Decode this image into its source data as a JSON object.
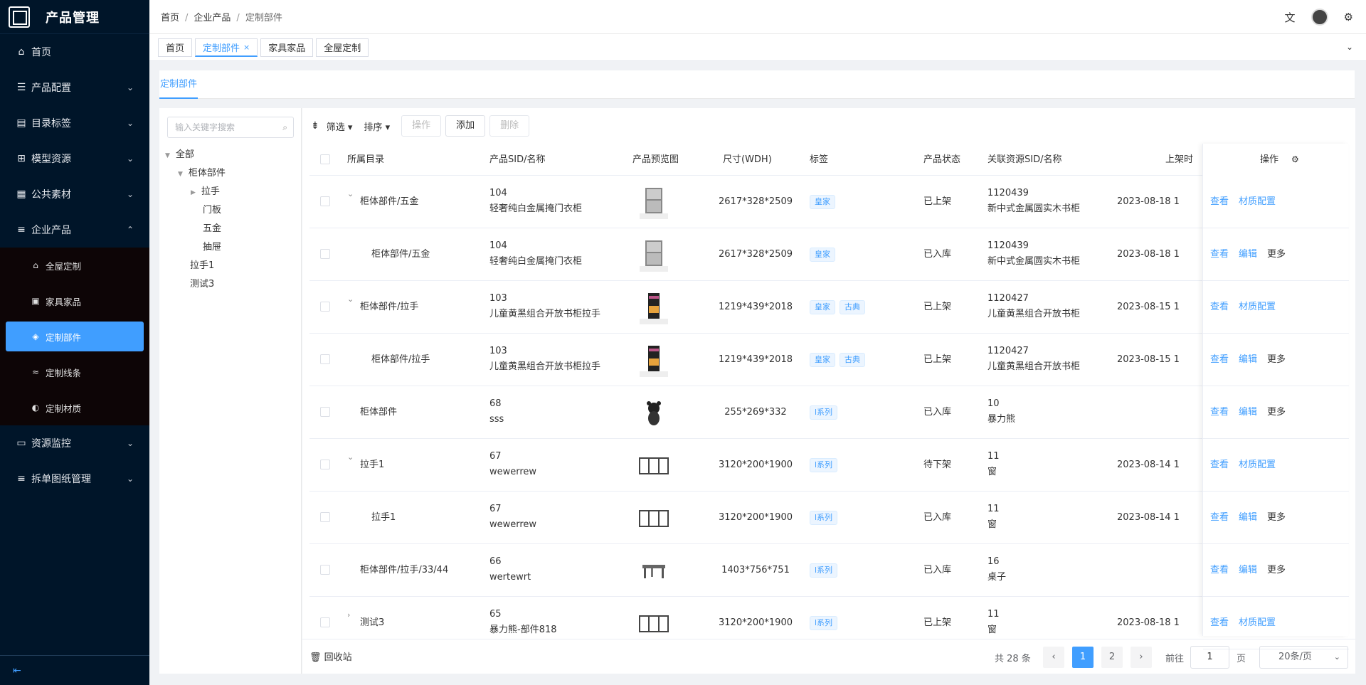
{
  "app": {
    "title": "产品管理"
  },
  "sidebar": {
    "items": [
      {
        "label": "首页",
        "icon": "home-icon"
      },
      {
        "label": "产品配置",
        "icon": "list-icon"
      },
      {
        "label": "目录标签",
        "icon": "document-icon"
      },
      {
        "label": "模型资源",
        "icon": "grid-icon"
      },
      {
        "label": "公共素材",
        "icon": "table-icon"
      },
      {
        "label": "企业产品",
        "icon": "database-icon"
      }
    ],
    "subitems": [
      {
        "label": "全屋定制",
        "icon": "house-icon"
      },
      {
        "label": "家具家品",
        "icon": "cabinet-icon"
      },
      {
        "label": "定制部件",
        "icon": "layers-icon"
      },
      {
        "label": "定制线条",
        "icon": "lines-icon"
      },
      {
        "label": "定制材质",
        "icon": "palette-icon"
      }
    ],
    "items_after": [
      {
        "label": "资源监控",
        "icon": "monitor-icon"
      },
      {
        "label": "拆单图纸管理",
        "icon": "database-icon"
      }
    ]
  },
  "breadcrumb": [
    "首页",
    "企业产品",
    "定制部件"
  ],
  "tags": [
    "首页",
    "定制部件",
    "家具家品",
    "全屋定制"
  ],
  "inner_tab": "定制部件",
  "tree": {
    "search_placeholder": "输入关键字搜索",
    "nodes": [
      "全部",
      "柜体部件",
      "拉手",
      "门板",
      "五金",
      "抽屉",
      "拉手1",
      "测试3"
    ]
  },
  "toolbar": {
    "filter": "筛选",
    "sort": "排序",
    "operate": "操作",
    "add": "添加",
    "delete": "删除"
  },
  "table": {
    "headers": {
      "catalog": "所属目录",
      "sid": "产品SID/名称",
      "preview": "产品预览图",
      "size": "尺寸(WDH)",
      "tags": "标签",
      "status": "产品状态",
      "resource": "关联资源SID/名称",
      "listed": "上架时",
      "actions": "操作"
    },
    "rows": [
      {
        "catalog": "柜体部件/五金",
        "sid": "104",
        "name": "轻奢纯白金属掩门衣柜",
        "size": "2617*328*2509",
        "tags": [
          "皇家"
        ],
        "status": "已上架",
        "rsid": "1120439",
        "rname": "新中式金属圆实木书柜",
        "date": "2023-08-18 1",
        "actions": [
          "查看",
          "材质配置"
        ]
      },
      {
        "catalog": "柜体部件/五金",
        "sid": "104",
        "name": "轻奢纯白金属掩门衣柜",
        "size": "2617*328*2509",
        "tags": [
          "皇家"
        ],
        "status": "已入库",
        "rsid": "1120439",
        "rname": "新中式金属圆实木书柜",
        "date": "2023-08-18 1",
        "actions": [
          "查看",
          "编辑",
          "更多"
        ]
      },
      {
        "catalog": "柜体部件/拉手",
        "sid": "103",
        "name": "儿童黄黑组合开放书柜拉手",
        "size": "1219*439*2018",
        "tags": [
          "皇家",
          "古典"
        ],
        "status": "已上架",
        "rsid": "1120427",
        "rname": "儿童黄黑组合开放书柜",
        "date": "2023-08-15 1",
        "actions": [
          "查看",
          "材质配置"
        ]
      },
      {
        "catalog": "柜体部件/拉手",
        "sid": "103",
        "name": "儿童黄黑组合开放书柜拉手",
        "size": "1219*439*2018",
        "tags": [
          "皇家",
          "古典"
        ],
        "status": "已上架",
        "rsid": "1120427",
        "rname": "儿童黄黑组合开放书柜",
        "date": "2023-08-15 1",
        "actions": [
          "查看",
          "编辑",
          "更多"
        ]
      },
      {
        "catalog": "柜体部件",
        "sid": "68",
        "name": "sss",
        "size": "255*269*332",
        "tags": [
          "l系列"
        ],
        "status": "已入库",
        "rsid": "10",
        "rname": "暴力熊",
        "date": "",
        "actions": [
          "查看",
          "编辑",
          "更多"
        ]
      },
      {
        "catalog": "拉手1",
        "sid": "67",
        "name": "wewerrew",
        "size": "3120*200*1900",
        "tags": [
          "l系列"
        ],
        "status": "待下架",
        "rsid": "11",
        "rname": "窗",
        "date": "2023-08-14 1",
        "actions": [
          "查看",
          "材质配置"
        ]
      },
      {
        "catalog": "拉手1",
        "sid": "67",
        "name": "wewerrew",
        "size": "3120*200*1900",
        "tags": [
          "l系列"
        ],
        "status": "已入库",
        "rsid": "11",
        "rname": "窗",
        "date": "2023-08-14 1",
        "actions": [
          "查看",
          "编辑",
          "更多"
        ]
      },
      {
        "catalog": "柜体部件/拉手/33/44",
        "sid": "66",
        "name": "wertewrt",
        "size": "1403*756*751",
        "tags": [
          "l系列"
        ],
        "status": "已入库",
        "rsid": "16",
        "rname": "桌子",
        "date": "",
        "actions": [
          "查看",
          "编辑",
          "更多"
        ]
      },
      {
        "catalog": "测试3",
        "sid": "65",
        "name": "暴力熊-部件818",
        "size": "3120*200*1900",
        "tags": [
          "l系列"
        ],
        "status": "已上架",
        "rsid": "11",
        "rname": "窗",
        "date": "2023-08-18 1",
        "actions": [
          "查看",
          "材质配置"
        ]
      }
    ]
  },
  "pagination": {
    "recycle": "回收站",
    "total": "共 28 条",
    "pages": [
      "1",
      "2"
    ],
    "goto": "前往",
    "goto_value": "1",
    "page_unit": "页",
    "page_size": "20条/页"
  },
  "colors": {
    "accent": "#409eff",
    "sidebar_bg": "#001529",
    "submenu_bg": "#0d0506"
  }
}
